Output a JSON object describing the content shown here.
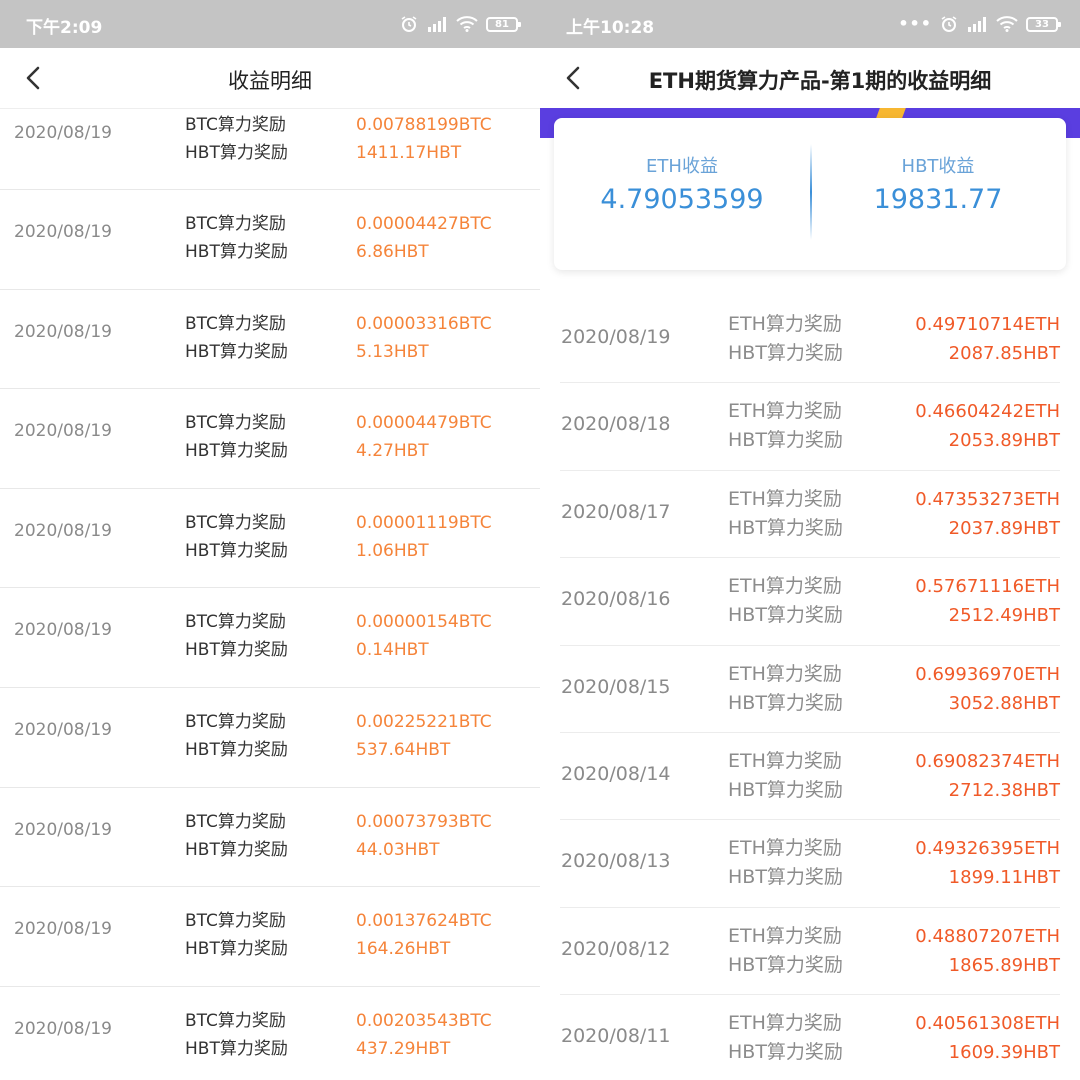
{
  "left": {
    "status_time": "下午2:09",
    "battery": "81",
    "title": "收益明细",
    "rows": [
      {
        "date": "2020/08/19",
        "label1": "BTC算力奖励",
        "value1": "0.00788199BTC",
        "label2": "HBT算力奖励",
        "value2": "1411.17HBT"
      },
      {
        "date": "2020/08/19",
        "label1": "BTC算力奖励",
        "value1": "0.00004427BTC",
        "label2": "HBT算力奖励",
        "value2": "6.86HBT"
      },
      {
        "date": "2020/08/19",
        "label1": "BTC算力奖励",
        "value1": "0.00003316BTC",
        "label2": "HBT算力奖励",
        "value2": "5.13HBT"
      },
      {
        "date": "2020/08/19",
        "label1": "BTC算力奖励",
        "value1": "0.00004479BTC",
        "label2": "HBT算力奖励",
        "value2": "4.27HBT"
      },
      {
        "date": "2020/08/19",
        "label1": "BTC算力奖励",
        "value1": "0.00001119BTC",
        "label2": "HBT算力奖励",
        "value2": "1.06HBT"
      },
      {
        "date": "2020/08/19",
        "label1": "BTC算力奖励",
        "value1": "0.00000154BTC",
        "label2": "HBT算力奖励",
        "value2": "0.14HBT"
      },
      {
        "date": "2020/08/19",
        "label1": "BTC算力奖励",
        "value1": "0.00225221BTC",
        "label2": "HBT算力奖励",
        "value2": "537.64HBT"
      },
      {
        "date": "2020/08/19",
        "label1": "BTC算力奖励",
        "value1": "0.00073793BTC",
        "label2": "HBT算力奖励",
        "value2": "44.03HBT"
      },
      {
        "date": "2020/08/19",
        "label1": "BTC算力奖励",
        "value1": "0.00137624BTC",
        "label2": "HBT算力奖励",
        "value2": "164.26HBT"
      },
      {
        "date": "2020/08/19",
        "label1": "BTC算力奖励",
        "value1": "0.00203543BTC",
        "label2": "HBT算力奖励",
        "value2": "437.29HBT"
      }
    ]
  },
  "right": {
    "status_time": "上午10:28",
    "battery": "33",
    "title": "ETH期货算力产品-第1期的收益明细",
    "summary": {
      "eth_label": "ETH收益",
      "eth_value": "4.79053599",
      "hbt_label": "HBT收益",
      "hbt_value": "19831.77"
    },
    "rows": [
      {
        "date": "2020/08/19",
        "label1": "ETH算力奖励",
        "value1": "0.49710714ETH",
        "label2": "HBT算力奖励",
        "value2": "2087.85HBT"
      },
      {
        "date": "2020/08/18",
        "label1": "ETH算力奖励",
        "value1": "0.46604242ETH",
        "label2": "HBT算力奖励",
        "value2": "2053.89HBT"
      },
      {
        "date": "2020/08/17",
        "label1": "ETH算力奖励",
        "value1": "0.47353273ETH",
        "label2": "HBT算力奖励",
        "value2": "2037.89HBT"
      },
      {
        "date": "2020/08/16",
        "label1": "ETH算力奖励",
        "value1": "0.57671116ETH",
        "label2": "HBT算力奖励",
        "value2": "2512.49HBT"
      },
      {
        "date": "2020/08/15",
        "label1": "ETH算力奖励",
        "value1": "0.69936970ETH",
        "label2": "HBT算力奖励",
        "value2": "3052.88HBT"
      },
      {
        "date": "2020/08/14",
        "label1": "ETH算力奖励",
        "value1": "0.69082374ETH",
        "label2": "HBT算力奖励",
        "value2": "2712.38HBT"
      },
      {
        "date": "2020/08/13",
        "label1": "ETH算力奖励",
        "value1": "0.49326395ETH",
        "label2": "HBT算力奖励",
        "value2": "1899.11HBT"
      },
      {
        "date": "2020/08/12",
        "label1": "ETH算力奖励",
        "value1": "0.48807207ETH",
        "label2": "HBT算力奖励",
        "value2": "1865.89HBT"
      },
      {
        "date": "2020/08/11",
        "label1": "ETH算力奖励",
        "value1": "0.40561308ETH",
        "label2": "HBT算力奖励",
        "value2": "1609.39HBT"
      }
    ]
  },
  "colors": {
    "accent_orange": "#f5843a",
    "accent_red_orange": "#f05a28",
    "summary_blue": "#3a8fd8",
    "banner_purple": "#5a3ee0",
    "statusbar_gray": "#c4c4c4"
  },
  "icons": [
    "back-arrow-icon",
    "alarm-icon",
    "signal-icon",
    "wifi-icon",
    "battery-icon"
  ]
}
